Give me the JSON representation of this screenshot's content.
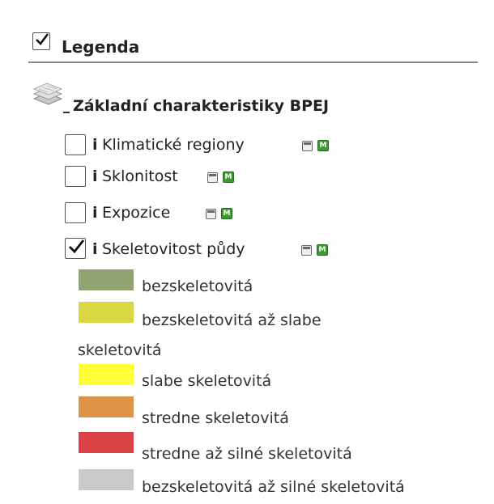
{
  "legend": {
    "title": "Legenda",
    "checked": true,
    "group": {
      "name": "Základní charakteristiky BPEJ",
      "collapse_icon": "minus-icon",
      "icon": "stacked-layers-icon"
    },
    "info_label": "i",
    "metadata_label": "M",
    "layers": [
      {
        "name": "Klimatické regiony",
        "checked": false
      },
      {
        "name": "Sklonitost",
        "checked": false
      },
      {
        "name": "Expozice",
        "checked": false
      },
      {
        "name": "Skeletovitost půdy",
        "checked": true
      }
    ],
    "items": [
      {
        "label": "bezskeletovitá",
        "color": "#90a472"
      },
      {
        "label": "bezskeletovitá až slabe",
        "label_cont": "skeletovitá",
        "color": "#d8d641"
      },
      {
        "label": "slabe skeletovitá",
        "color": "#ffff38"
      },
      {
        "label": "stredne skeletovitá",
        "color": "#db9347"
      },
      {
        "label": "stredne až silné skeletovitá",
        "color": "#db4245"
      },
      {
        "label": "bezskeletovitá až silné skeletovitá",
        "color": "#c9c9c9"
      }
    ]
  }
}
